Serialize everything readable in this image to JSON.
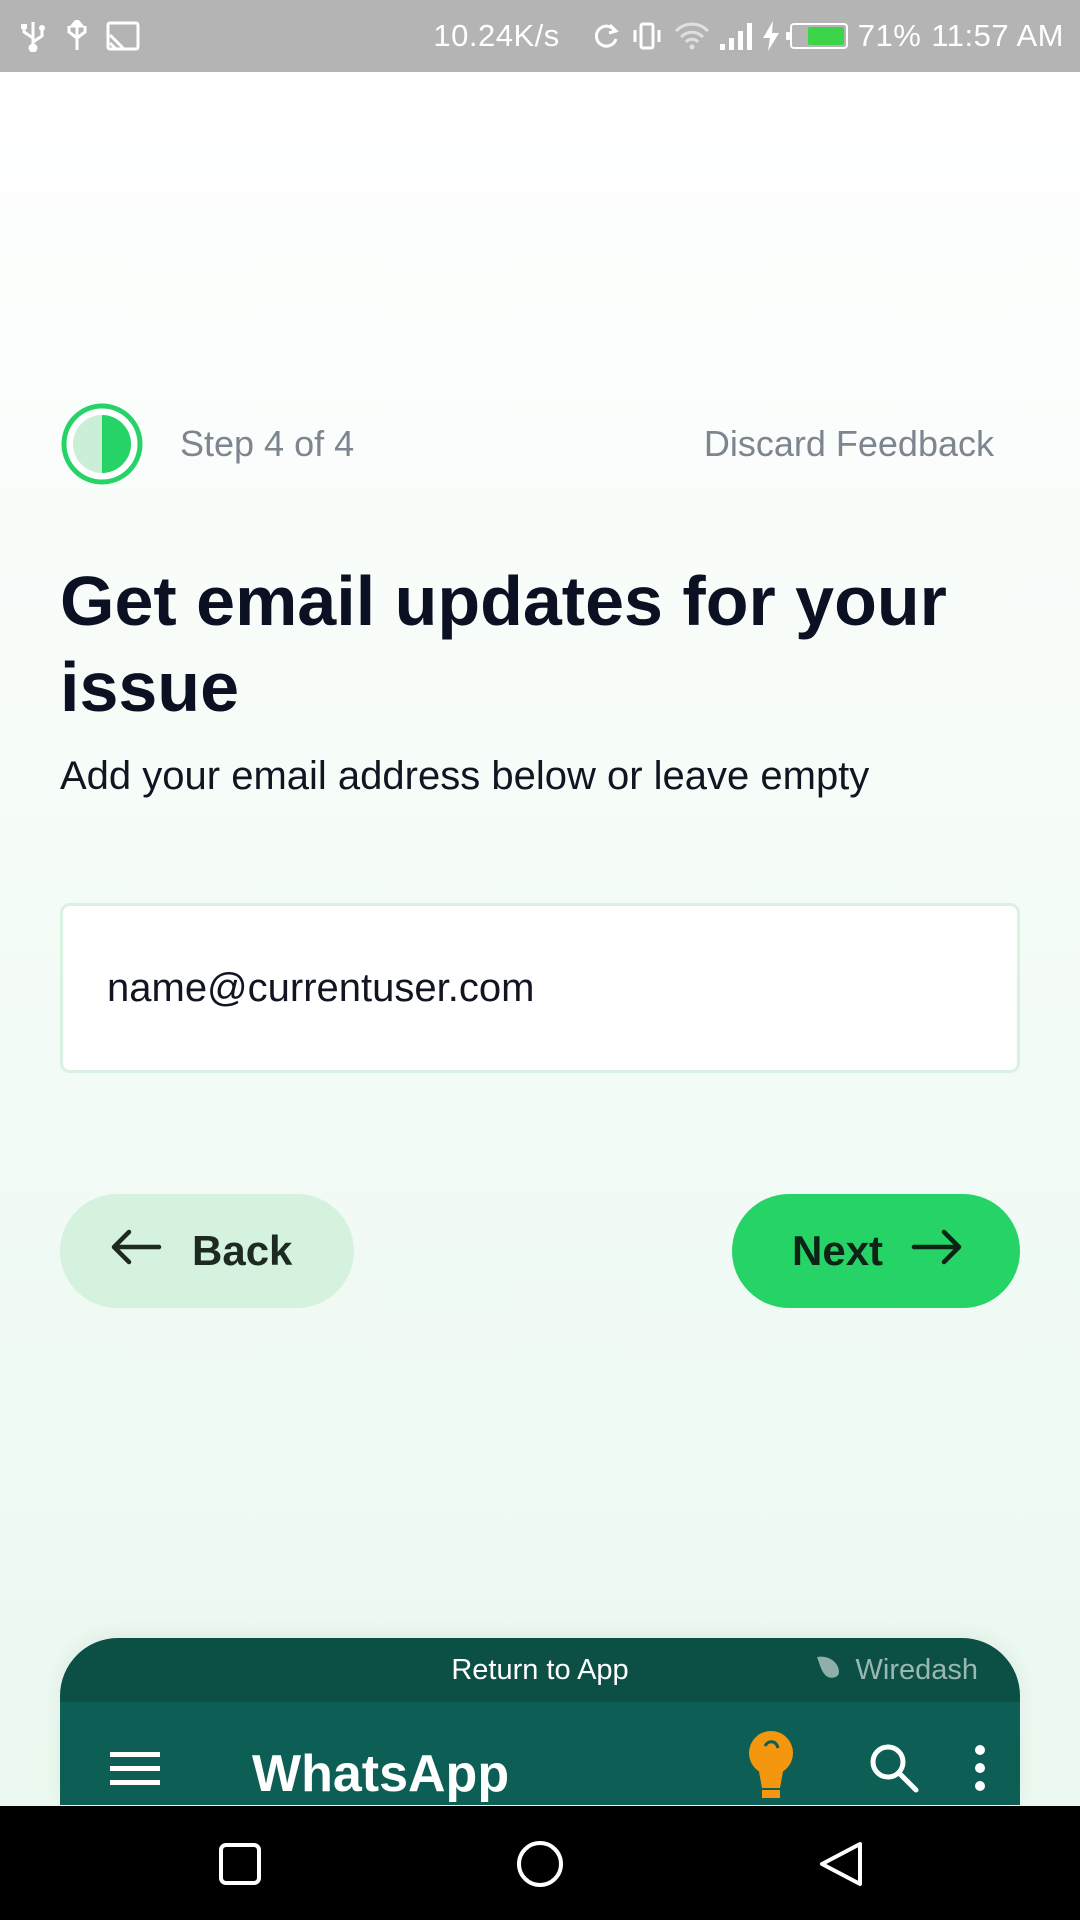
{
  "status_bar": {
    "network_speed": "10.24K/s",
    "battery_percent": "71%",
    "battery_level": 0.71,
    "time": "11:57 AM",
    "icons": [
      "usb-icon",
      "usb-icon",
      "screen-cast-icon",
      "sync-icon",
      "vibrate-icon",
      "wifi-icon",
      "signal-icon",
      "charging-icon",
      "battery-icon"
    ]
  },
  "step": {
    "label": "Step 4 of 4",
    "current": 4,
    "total": 4,
    "discard_label": "Discard Feedback"
  },
  "content": {
    "title": "Get email updates for your issue",
    "subtitle": "Add your email address below or leave empty"
  },
  "email": {
    "value": "name@currentuser.com"
  },
  "buttons": {
    "back_label": "Back",
    "next_label": "Next"
  },
  "preview": {
    "return_label": "Return to App",
    "brand": "Wiredash",
    "app_title": "WhatsApp"
  },
  "colors": {
    "accent": "#25d366",
    "back_button_bg": "#d5f2de",
    "title_text": "#0b1023",
    "preview_bar": "#0b4f45",
    "app_bar": "#0d5f55",
    "bulb": "#f5960f"
  }
}
